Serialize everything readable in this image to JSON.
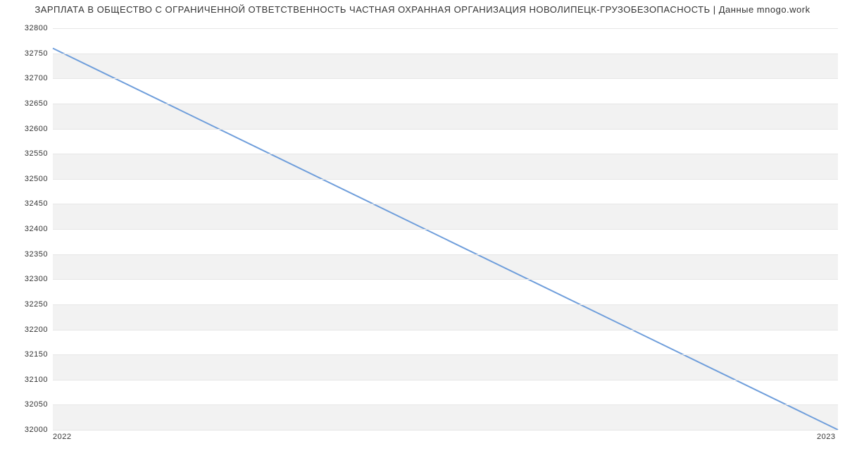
{
  "chart_data": {
    "type": "line",
    "title": "ЗАРПЛАТА В ОБЩЕСТВО С ОГРАНИЧЕННОЙ ОТВЕТСТВЕННОСТЬ ЧАСТНАЯ ОХРАННАЯ ОРГАНИЗАЦИЯ НОВОЛИПЕЦК-ГРУЗОБЕЗОПАСНОСТЬ | Данные mnogo.work",
    "x": [
      2022,
      2023
    ],
    "values": [
      32760,
      32000
    ],
    "xlabel": "",
    "ylabel": "",
    "ylim": [
      32000,
      32800
    ],
    "yticks": [
      32000,
      32050,
      32100,
      32150,
      32200,
      32250,
      32300,
      32350,
      32400,
      32450,
      32500,
      32550,
      32600,
      32650,
      32700,
      32750,
      32800
    ],
    "xticks": [
      2022,
      2023
    ],
    "line_color": "#6f9edb"
  }
}
